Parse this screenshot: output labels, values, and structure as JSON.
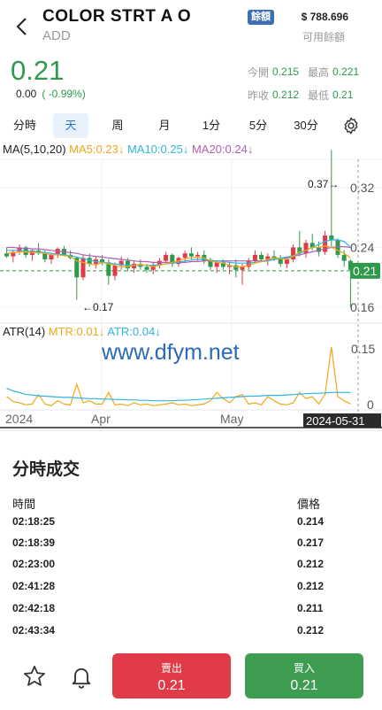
{
  "header": {
    "title": "COLOR STRT A O",
    "subtitle": "ADD",
    "balance_badge": "餘額",
    "balance": "$ 788.696",
    "balance_label": "可用餘額"
  },
  "quote": {
    "price": "0.21",
    "change": "0.00",
    "change_pct": "( -0.99%)",
    "open_label": "今開",
    "open": "0.215",
    "high_label": "最高",
    "high": "0.221",
    "prev_close_label": "昨收",
    "prev_close": "0.212",
    "low_label": "最低",
    "low": "0.21"
  },
  "tabs": [
    {
      "label": "分時",
      "active": false
    },
    {
      "label": "天",
      "active": true
    },
    {
      "label": "周",
      "active": false
    },
    {
      "label": "月",
      "active": false
    },
    {
      "label": "1分",
      "active": false
    },
    {
      "label": "5分",
      "active": false
    },
    {
      "label": "30分",
      "active": false
    }
  ],
  "chart": {
    "ma_legend": {
      "title": "MA(5,10,20)",
      "ma5": "MA5:0.23↓",
      "ma10": "MA10:0.25↓",
      "ma20": "MA20:0.24↓"
    },
    "atr_legend": {
      "title": "ATR(14)",
      "mtr": "MTR:0.01↓",
      "atr": "ATR:0.04↓"
    },
    "watermark": "www.dfym.net",
    "price_axis": [
      "0.32",
      "0.24",
      "0.16"
    ],
    "atr_axis": [
      "0.15",
      "0"
    ],
    "current_price_tag": "0.21",
    "high_annotation": "0.37→",
    "low_annotation": "←0.17",
    "date_labels": [
      "2024",
      "Apr",
      "May"
    ],
    "crosshair_date": "2024-05-31",
    "colors": {
      "up": "#e03b46",
      "down": "#2e9a4c",
      "ma5": "#f2a71b",
      "ma10": "#31b4e0",
      "ma20": "#b35eb0"
    }
  },
  "chart_data": {
    "type": "candlestick",
    "y_range": [
      0.14,
      0.36
    ],
    "atr_range": [
      0,
      0.165
    ],
    "candles": [
      [
        0.232,
        0.24,
        0.226,
        0.228
      ],
      [
        0.228,
        0.236,
        0.22,
        0.234
      ],
      [
        0.234,
        0.244,
        0.23,
        0.24
      ],
      [
        0.24,
        0.242,
        0.226,
        0.23
      ],
      [
        0.23,
        0.238,
        0.222,
        0.236
      ],
      [
        0.236,
        0.246,
        0.23,
        0.232
      ],
      [
        0.232,
        0.236,
        0.22,
        0.224
      ],
      [
        0.224,
        0.232,
        0.218,
        0.23
      ],
      [
        0.23,
        0.24,
        0.226,
        0.238
      ],
      [
        0.238,
        0.242,
        0.228,
        0.23
      ],
      [
        0.23,
        0.236,
        0.224,
        0.226
      ],
      [
        0.226,
        0.228,
        0.17,
        0.2
      ],
      [
        0.2,
        0.23,
        0.196,
        0.226
      ],
      [
        0.226,
        0.232,
        0.214,
        0.218
      ],
      [
        0.218,
        0.228,
        0.212,
        0.224
      ],
      [
        0.224,
        0.23,
        0.216,
        0.22
      ],
      [
        0.22,
        0.224,
        0.19,
        0.202
      ],
      [
        0.202,
        0.22,
        0.196,
        0.216
      ],
      [
        0.216,
        0.228,
        0.21,
        0.222
      ],
      [
        0.222,
        0.226,
        0.208,
        0.212
      ],
      [
        0.212,
        0.222,
        0.206,
        0.218
      ],
      [
        0.218,
        0.224,
        0.21,
        0.214
      ],
      [
        0.214,
        0.218,
        0.206,
        0.21
      ],
      [
        0.21,
        0.22,
        0.204,
        0.216
      ],
      [
        0.216,
        0.226,
        0.212,
        0.222
      ],
      [
        0.222,
        0.234,
        0.218,
        0.23
      ],
      [
        0.23,
        0.232,
        0.214,
        0.218
      ],
      [
        0.218,
        0.228,
        0.214,
        0.226
      ],
      [
        0.226,
        0.236,
        0.22,
        0.232
      ],
      [
        0.232,
        0.24,
        0.224,
        0.228
      ],
      [
        0.228,
        0.234,
        0.222,
        0.23
      ],
      [
        0.23,
        0.236,
        0.218,
        0.222
      ],
      [
        0.222,
        0.226,
        0.21,
        0.214
      ],
      [
        0.214,
        0.222,
        0.206,
        0.22
      ],
      [
        0.22,
        0.224,
        0.21,
        0.214
      ],
      [
        0.214,
        0.22,
        0.204,
        0.216
      ],
      [
        0.216,
        0.224,
        0.2,
        0.21
      ],
      [
        0.21,
        0.218,
        0.19,
        0.214
      ],
      [
        0.214,
        0.226,
        0.21,
        0.222
      ],
      [
        0.222,
        0.236,
        0.218,
        0.23
      ],
      [
        0.23,
        0.234,
        0.22,
        0.224
      ],
      [
        0.224,
        0.232,
        0.216,
        0.228
      ],
      [
        0.228,
        0.236,
        0.222,
        0.226
      ],
      [
        0.226,
        0.23,
        0.214,
        0.218
      ],
      [
        0.218,
        0.228,
        0.212,
        0.224
      ],
      [
        0.224,
        0.244,
        0.22,
        0.24
      ],
      [
        0.24,
        0.262,
        0.228,
        0.232
      ],
      [
        0.232,
        0.25,
        0.226,
        0.246
      ],
      [
        0.246,
        0.258,
        0.236,
        0.24
      ],
      [
        0.24,
        0.248,
        0.228,
        0.234
      ],
      [
        0.234,
        0.262,
        0.23,
        0.256
      ],
      [
        0.256,
        0.37,
        0.24,
        0.25
      ],
      [
        0.25,
        0.252,
        0.226,
        0.23
      ],
      [
        0.23,
        0.236,
        0.214,
        0.222
      ],
      [
        0.222,
        0.224,
        0.16,
        0.21
      ]
    ],
    "ma5": [
      0.232,
      0.233,
      0.234,
      0.234,
      0.233,
      0.233,
      0.232,
      0.23,
      0.23,
      0.229,
      0.228,
      0.222,
      0.22,
      0.218,
      0.216,
      0.22,
      0.218,
      0.216,
      0.214,
      0.214,
      0.216,
      0.217,
      0.216,
      0.214,
      0.216,
      0.218,
      0.22,
      0.222,
      0.225,
      0.226,
      0.227,
      0.226,
      0.222,
      0.22,
      0.219,
      0.216,
      0.214,
      0.214,
      0.216,
      0.219,
      0.221,
      0.224,
      0.226,
      0.225,
      0.224,
      0.228,
      0.234,
      0.236,
      0.24,
      0.24,
      0.242,
      0.24,
      0.236,
      0.232,
      0.226
    ],
    "ma10": [
      0.236,
      0.236,
      0.236,
      0.235,
      0.235,
      0.234,
      0.233,
      0.232,
      0.231,
      0.23,
      0.229,
      0.227,
      0.225,
      0.223,
      0.221,
      0.22,
      0.219,
      0.218,
      0.217,
      0.216,
      0.216,
      0.216,
      0.216,
      0.216,
      0.217,
      0.218,
      0.219,
      0.22,
      0.222,
      0.223,
      0.224,
      0.224,
      0.223,
      0.222,
      0.221,
      0.22,
      0.219,
      0.219,
      0.219,
      0.22,
      0.221,
      0.222,
      0.224,
      0.226,
      0.227,
      0.229,
      0.232,
      0.236,
      0.24,
      0.244,
      0.248,
      0.25,
      0.25,
      0.248,
      0.24
    ],
    "ma20": [
      0.24,
      0.24,
      0.239,
      0.239,
      0.238,
      0.238,
      0.237,
      0.236,
      0.235,
      0.234,
      0.233,
      0.232,
      0.23,
      0.229,
      0.228,
      0.227,
      0.226,
      0.225,
      0.224,
      0.223,
      0.222,
      0.221,
      0.221,
      0.22,
      0.22,
      0.22,
      0.22,
      0.22,
      0.22,
      0.221,
      0.221,
      0.222,
      0.222,
      0.222,
      0.222,
      0.222,
      0.222,
      0.222,
      0.222,
      0.222,
      0.222,
      0.223,
      0.224,
      0.225,
      0.226,
      0.228,
      0.23,
      0.232,
      0.234,
      0.236,
      0.238,
      0.24,
      0.241,
      0.241,
      0.24
    ],
    "mtr": [
      0.03,
      0.018,
      0.015,
      0.01,
      0.012,
      0.035,
      0.012,
      0.008,
      0.02,
      0.012,
      0.01,
      0.06,
      0.015,
      0.02,
      0.012,
      0.012,
      0.04,
      0.01,
      0.012,
      0.008,
      0.015,
      0.01,
      0.012,
      0.008,
      0.01,
      0.012,
      0.015,
      0.01,
      0.012,
      0.008,
      0.01,
      0.012,
      0.02,
      0.04,
      0.025,
      0.015,
      0.03,
      0.035,
      0.012,
      0.015,
      0.01,
      0.03,
      0.02,
      0.012,
      0.01,
      0.015,
      0.04,
      0.025,
      0.03,
      0.012,
      0.035,
      0.15,
      0.03,
      0.02,
      0.012
    ],
    "atr": [
      0.05,
      0.044,
      0.04,
      0.035,
      0.034,
      0.032,
      0.031,
      0.03,
      0.029,
      0.028,
      0.028,
      0.027,
      0.026,
      0.025,
      0.025,
      0.024,
      0.024,
      0.023,
      0.023,
      0.022,
      0.022,
      0.021,
      0.021,
      0.02,
      0.02,
      0.02,
      0.02,
      0.021,
      0.021,
      0.022,
      0.023,
      0.024,
      0.025,
      0.026,
      0.027,
      0.028,
      0.029,
      0.03,
      0.031,
      0.031,
      0.032,
      0.033,
      0.033,
      0.033,
      0.034,
      0.035,
      0.036,
      0.037,
      0.038,
      0.038,
      0.039,
      0.04,
      0.04,
      0.04,
      0.04
    ]
  },
  "trades": {
    "title": "分時成交",
    "time_header": "時間",
    "price_header": "價格",
    "rows": [
      {
        "time": "02:18:25",
        "price": "0.214"
      },
      {
        "time": "02:18:39",
        "price": "0.217"
      },
      {
        "time": "02:23:00",
        "price": "0.212"
      },
      {
        "time": "02:41:28",
        "price": "0.212"
      },
      {
        "time": "02:42:18",
        "price": "0.211"
      },
      {
        "time": "02:43:34",
        "price": "0.212"
      }
    ]
  },
  "actions": {
    "sell_label": "賣出",
    "sell_price": "0.21",
    "buy_label": "買入",
    "buy_price": "0.21"
  }
}
